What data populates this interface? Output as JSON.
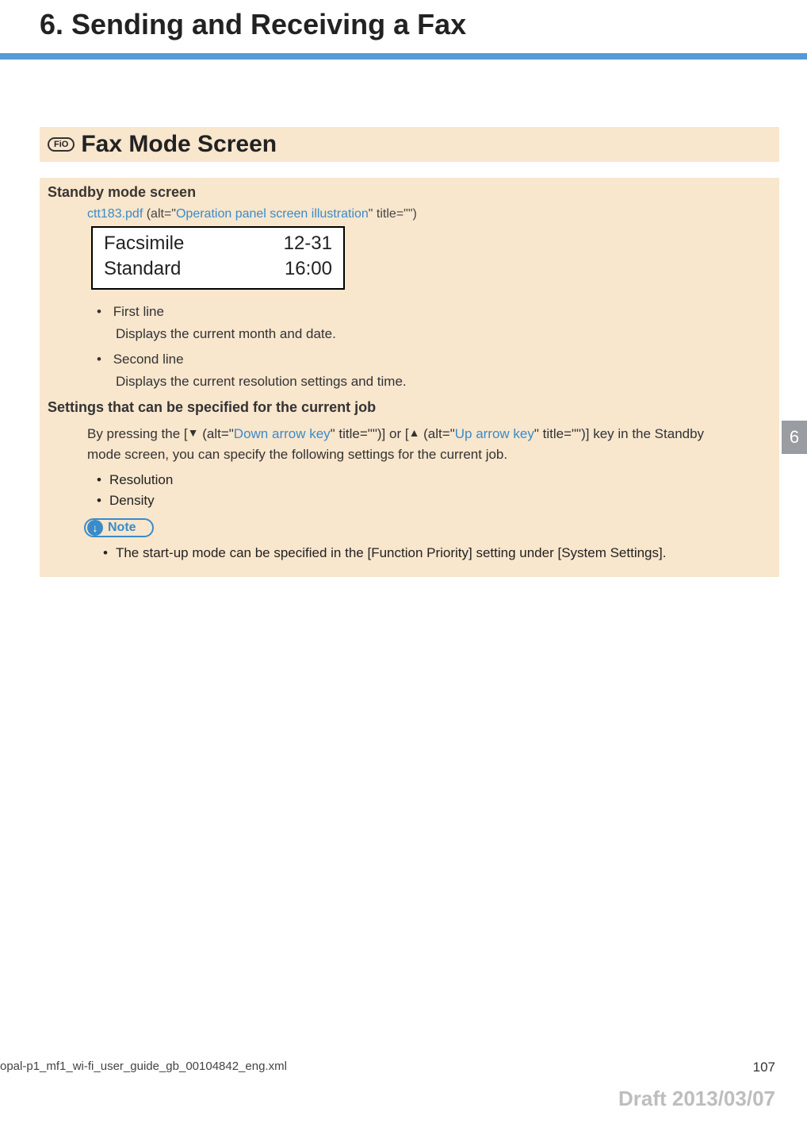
{
  "chapter": {
    "title": "6. Sending and Receiving a Fax",
    "tab_number": "6"
  },
  "section": {
    "badge": "FiO",
    "title": "Fax Mode Screen"
  },
  "standby": {
    "heading": "Standby mode screen",
    "image_ref": {
      "filename": "ctt183.pdf",
      "alt_label": "Operation panel screen illustration"
    },
    "lcd": {
      "r1c1": "Facsimile",
      "r1c2": "12-31",
      "r2c1": "Standard",
      "r2c2": "16:00"
    },
    "items": [
      {
        "label": "First line",
        "desc": "Displays the current month and date."
      },
      {
        "label": "Second line",
        "desc": "Displays the current resolution settings and time."
      }
    ]
  },
  "settings": {
    "heading": "Settings that can be specified for the current job",
    "sentence": {
      "pre": "By pressing the [",
      "down_arrow": "▼",
      "down_alt_pre": " (alt=\"",
      "down_alt": "Down arrow key",
      "down_alt_post": "\" title=\"\")] or [",
      "up_arrow": "▲",
      "up_alt_pre": " (alt=\"",
      "up_alt": "Up arrow key",
      "up_alt_post": "\" title=\"\")] key in the Standby mode screen, you can specify the following settings for the current job."
    },
    "bullets": [
      "Resolution",
      "Density"
    ]
  },
  "note": {
    "label": "Note",
    "arrow": "↓",
    "items": [
      "The start-up mode can be specified in the [Function Priority] setting under [System Settings]."
    ]
  },
  "footer": {
    "filename": "opal-p1_mf1_wi-fi_user_guide_gb_00104842_eng.xml",
    "page": "107",
    "draft": "Draft 2013/03/07"
  }
}
